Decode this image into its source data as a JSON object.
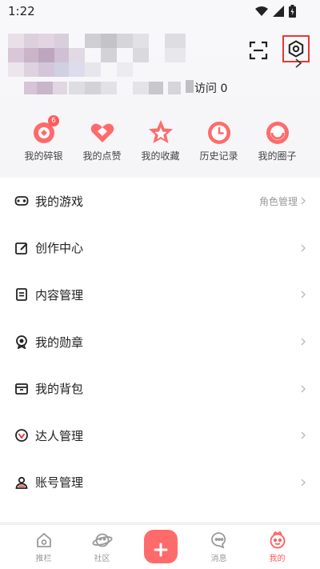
{
  "status": {
    "time": "1:22"
  },
  "header": {
    "visits_label": "访问 0",
    "scan_icon": "scan-icon",
    "settings_icon": "settings-gear-icon"
  },
  "quick_actions": [
    {
      "label": "我的碎银",
      "icon": "coin-icon",
      "badge": "6"
    },
    {
      "label": "我的点赞",
      "icon": "heart-icon"
    },
    {
      "label": "我的收藏",
      "icon": "star-icon"
    },
    {
      "label": "历史记录",
      "icon": "clock-icon"
    },
    {
      "label": "我的圈子",
      "icon": "circle-icon"
    }
  ],
  "menu": [
    {
      "label": "我的游戏",
      "value": "角色管理",
      "icon": "gamepad-icon"
    },
    {
      "label": "创作中心",
      "value": "",
      "icon": "edit-icon"
    },
    {
      "label": "内容管理",
      "value": "",
      "icon": "document-icon"
    },
    {
      "label": "我的勋章",
      "value": "",
      "icon": "medal-icon"
    },
    {
      "label": "我的背包",
      "value": "",
      "icon": "backpack-icon"
    },
    {
      "label": "达人管理",
      "value": "",
      "icon": "expert-icon"
    },
    {
      "label": "账号管理",
      "value": "",
      "icon": "account-icon"
    }
  ],
  "tabbar": [
    {
      "label": "推栏",
      "icon": "home-icon"
    },
    {
      "label": "社区",
      "icon": "planet-icon"
    },
    {
      "label": "",
      "icon": "plus-icon"
    },
    {
      "label": "消息",
      "icon": "message-icon"
    },
    {
      "label": "我的",
      "icon": "profile-icon"
    }
  ],
  "colors": {
    "accent": "#ff5b5b",
    "highlight_border": "#e53935"
  }
}
